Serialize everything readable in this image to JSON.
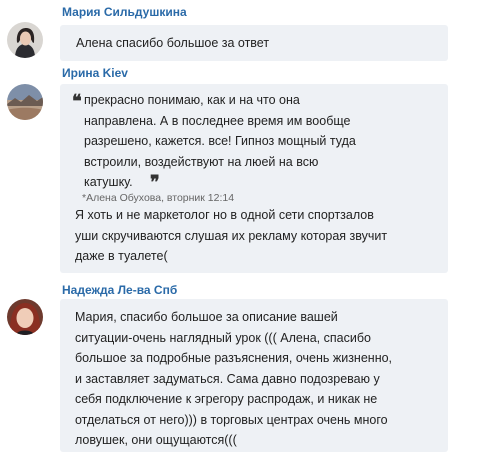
{
  "messages": [
    {
      "author": "Мария Сильдушкина",
      "avatar_icon": "user-avatar-icon",
      "lines": [
        "Алена спасибо большое за ответ"
      ]
    },
    {
      "author": "Ирина Kiev",
      "avatar_icon": "user-avatar-icon",
      "quote": {
        "open_mark": "❝",
        "close_mark": "❞",
        "lines": [
          "прекрасно понимаю, как и на что она",
          "направлена. А в последнее время им вообще",
          "разрешено, кажется. все! Гипноз мощный туда",
          "встроили, воздействуют на люей на всю",
          "катушку."
        ],
        "citation": "*Алена Обухова, вторник 12:14"
      },
      "lines": [
        "Я хоть и не маркетолог но в одной сети спортзалов",
        "уши скручиваются слушая их рекламу которая звучит",
        "даже в туалете("
      ]
    },
    {
      "author": "Надежда Ле-ва Спб",
      "avatar_icon": "user-avatar-icon",
      "lines": [
        "Мария, спасибо большое за описание вашей",
        "ситуации-очень наглядный урок ((( Алена, спасибо",
        "большое за подробные разъяснения, очень жизненно,",
        "и заставляет задуматься. Сама давно подозреваю у",
        "себя подключение к эгрегору распродаж, и никак не",
        "отделаться от него))) в торговых центрах очень много",
        "ловушек, они ощущаются((("
      ]
    }
  ],
  "colors": {
    "author": "#2a6aa8",
    "bubble": "#eef1f5",
    "text": "#222222"
  }
}
